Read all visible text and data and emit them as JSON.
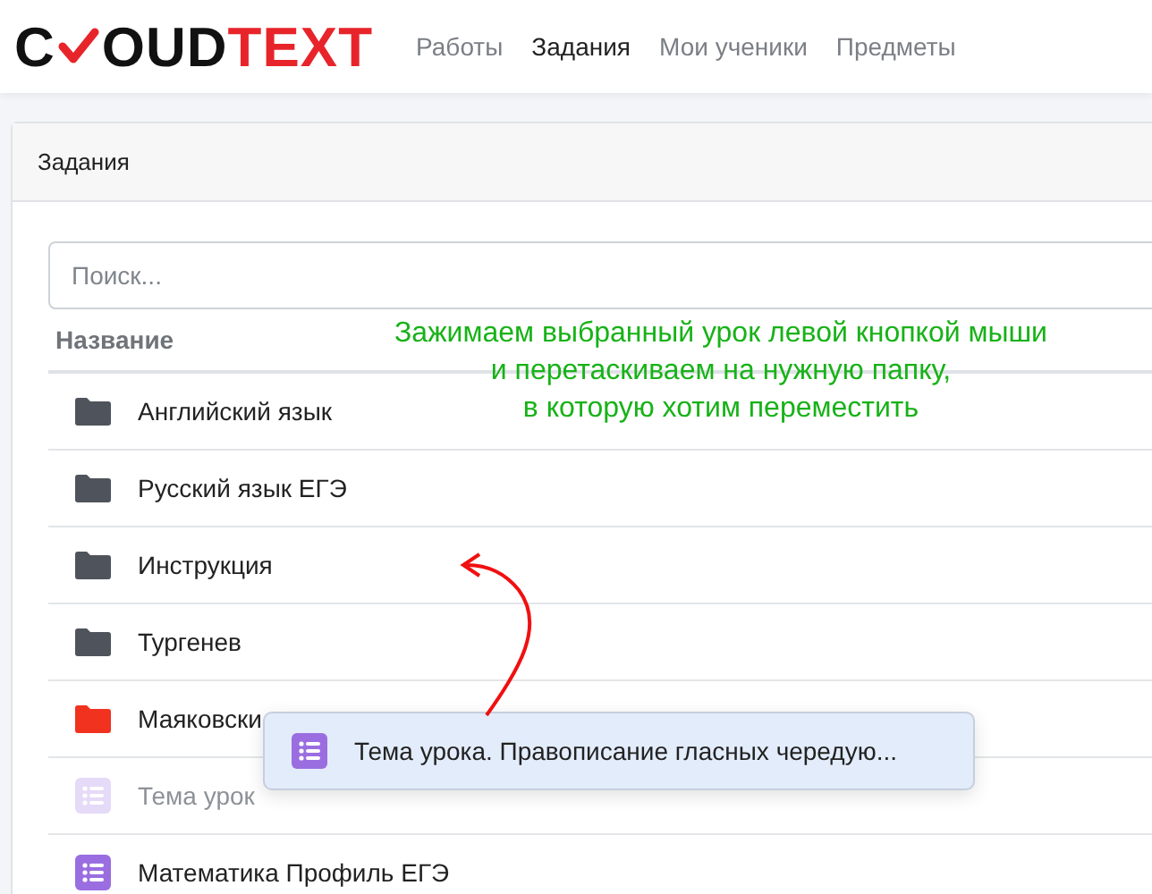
{
  "logo": {
    "start": "C",
    "middle": "OUD",
    "end": "TEXT"
  },
  "nav": [
    {
      "label": "Работы",
      "selected": false
    },
    {
      "label": "Задания",
      "selected": true
    },
    {
      "label": "Мои ученики",
      "selected": false
    },
    {
      "label": "Предметы",
      "selected": false
    }
  ],
  "card": {
    "title": "Задания"
  },
  "search": {
    "placeholder": "Поиск..."
  },
  "table": {
    "columns": [
      "Название"
    ],
    "rows": [
      {
        "kind": "folder",
        "name": "Английский язык",
        "drop_target": false,
        "dragging": false
      },
      {
        "kind": "folder",
        "name": "Русский язык ЕГЭ",
        "drop_target": false,
        "dragging": false
      },
      {
        "kind": "folder",
        "name": "Инструкция",
        "drop_target": false,
        "dragging": false
      },
      {
        "kind": "folder",
        "name": "Тургенев",
        "drop_target": false,
        "dragging": false
      },
      {
        "kind": "folder",
        "name": "Маяковски",
        "drop_target": true,
        "dragging": false
      },
      {
        "kind": "lesson",
        "name": "Тема урок",
        "dragging": true
      },
      {
        "kind": "lesson",
        "name": "Математика Профиль ЕГЭ",
        "dragging": false
      }
    ]
  },
  "drag_item": {
    "kind": "lesson",
    "name": "Тема урока. Правописание гласных чередую..."
  },
  "annotation": {
    "lines": [
      "Зажимаем выбранный урок левой кнопкой мыши",
      "и перетаскиваем на нужную папку,",
      "в которую хотим переместить"
    ]
  }
}
